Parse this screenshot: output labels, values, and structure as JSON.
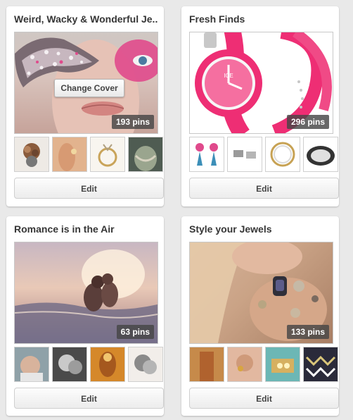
{
  "boards": [
    {
      "title": "Weird, Wacky & Wonderful Je...",
      "pins": "193 pins",
      "change_cover": "Change Cover",
      "edit": "Edit"
    },
    {
      "title": "Fresh Finds",
      "pins": "296 pins",
      "edit": "Edit"
    },
    {
      "title": "Romance is in the Air",
      "pins": "63 pins",
      "edit": "Edit"
    },
    {
      "title": "Style your Jewels",
      "pins": "133 pins",
      "edit": "Edit"
    }
  ],
  "colors": {
    "background": "#e9e9e9",
    "card": "#ffffff",
    "accent_pink": "#ea3f7c"
  }
}
